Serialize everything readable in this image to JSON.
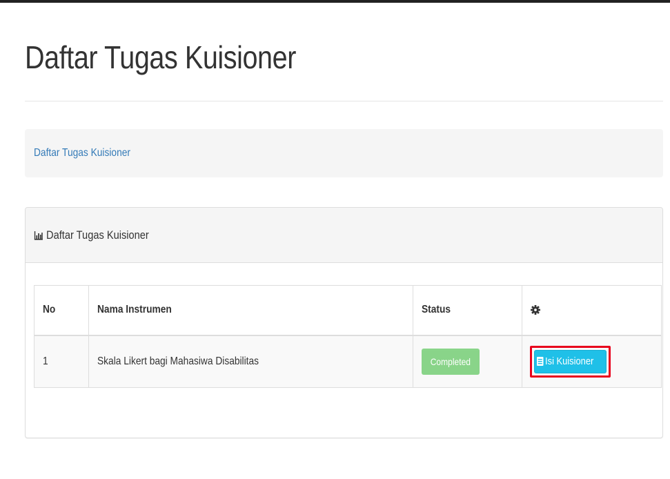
{
  "page": {
    "title": "Daftar Tugas Kuisioner"
  },
  "breadcrumb": {
    "items": [
      {
        "label": "Daftar Tugas Kuisioner"
      }
    ]
  },
  "panel": {
    "icon": "bar-chart-icon",
    "title": "Daftar Tugas Kuisioner",
    "table": {
      "columns": [
        {
          "label": "No"
        },
        {
          "label": "Nama Instrumen"
        },
        {
          "label": "Status"
        },
        {
          "label": "",
          "icon": "gear-icon"
        }
      ],
      "rows": [
        {
          "no": "1",
          "name": "Skala Likert bagi Mahasiwa Disabilitas",
          "status": "Completed",
          "action_label": "Isi Kuisioner",
          "action_icon": "document-icon"
        }
      ]
    }
  },
  "colors": {
    "link": "#337ab7",
    "status_completed": "#7dd07d",
    "action_button": "#1fc0e8",
    "highlight_frame": "#e8001c"
  }
}
